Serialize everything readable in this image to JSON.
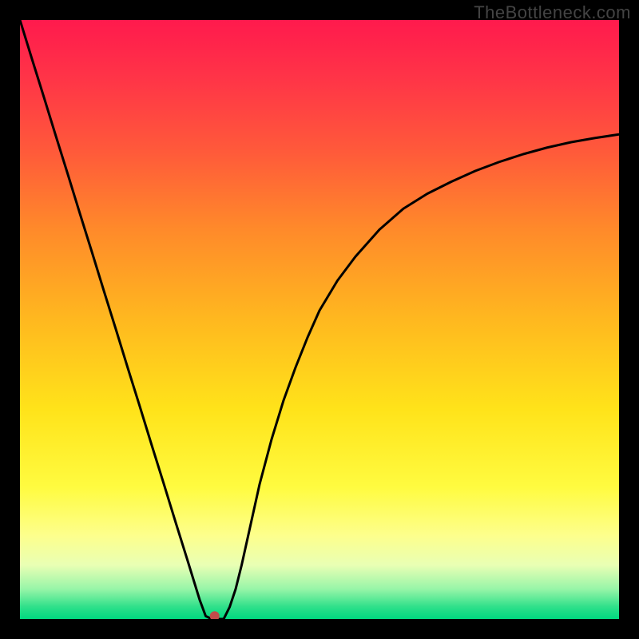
{
  "watermark": "TheBottleneck.com",
  "chart_data": {
    "type": "line",
    "title": "",
    "xlabel": "",
    "ylabel": "",
    "xlim": [
      0,
      100
    ],
    "ylim": [
      0,
      100
    ],
    "background_gradient": {
      "stops": [
        {
          "pos": 0.0,
          "color": "#ff1a4d"
        },
        {
          "pos": 0.1,
          "color": "#ff3547"
        },
        {
          "pos": 0.22,
          "color": "#ff5a3a"
        },
        {
          "pos": 0.35,
          "color": "#ff8a2a"
        },
        {
          "pos": 0.5,
          "color": "#ffb81f"
        },
        {
          "pos": 0.65,
          "color": "#ffe31a"
        },
        {
          "pos": 0.78,
          "color": "#fffb40"
        },
        {
          "pos": 0.86,
          "color": "#fdff8c"
        },
        {
          "pos": 0.91,
          "color": "#e9ffb4"
        },
        {
          "pos": 0.95,
          "color": "#97f5a8"
        },
        {
          "pos": 0.98,
          "color": "#2ee08a"
        },
        {
          "pos": 1.0,
          "color": "#00d980"
        }
      ]
    },
    "series": [
      {
        "name": "curve",
        "x": [
          0,
          2,
          4,
          6,
          8,
          10,
          12,
          14,
          16,
          18,
          20,
          22,
          24,
          26,
          28,
          30,
          31,
          32,
          33,
          34,
          35,
          36,
          37,
          38,
          39,
          40,
          42,
          44,
          46,
          48,
          50,
          53,
          56,
          60,
          64,
          68,
          72,
          76,
          80,
          84,
          88,
          92,
          96,
          100
        ],
        "y": [
          100,
          93.5,
          87.1,
          80.6,
          74.2,
          67.7,
          61.3,
          54.8,
          48.4,
          41.9,
          35.5,
          29.0,
          22.6,
          16.1,
          9.7,
          3.2,
          0.5,
          0.0,
          0.0,
          0.0,
          2.0,
          5.0,
          9.0,
          13.5,
          18.0,
          22.5,
          30.0,
          36.5,
          42.0,
          47.0,
          51.5,
          56.5,
          60.5,
          65.0,
          68.5,
          71.0,
          73.0,
          74.8,
          76.3,
          77.6,
          78.7,
          79.6,
          80.3,
          80.9
        ]
      }
    ],
    "marker": {
      "x": 32.5,
      "y": 0.5,
      "color": "#c34b4b",
      "r": 6
    }
  }
}
